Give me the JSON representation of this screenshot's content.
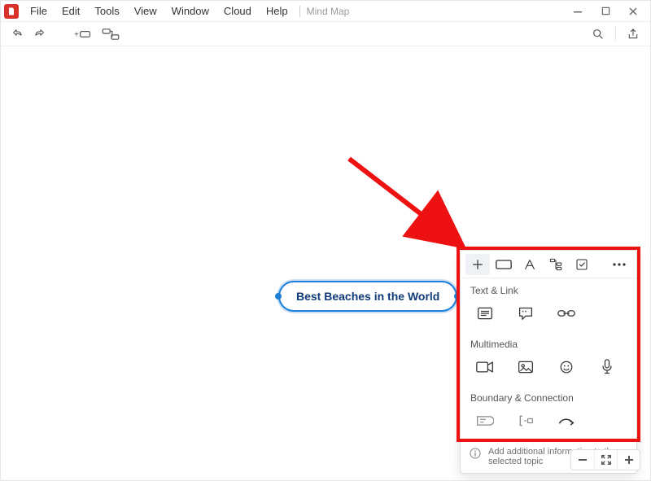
{
  "menu": {
    "file": "File",
    "edit": "Edit",
    "tools": "Tools",
    "view": "View",
    "window": "Window",
    "cloud": "Cloud",
    "help": "Help"
  },
  "doc_title": "Mind Map",
  "node": {
    "label": "Best Beaches in the World"
  },
  "panel": {
    "tabs": {
      "insert": "Insert",
      "shape": "Shape",
      "text": "Text",
      "structure": "Structure",
      "task": "Task",
      "more": "More"
    },
    "sections": {
      "text_link": "Text & Link",
      "multimedia": "Multimedia",
      "boundary_connection": "Boundary & Connection"
    },
    "footer": "Add additional information to the selected topic"
  },
  "zoom": {
    "out": "Zoom out",
    "fit": "Fit",
    "in": "Zoom in"
  }
}
